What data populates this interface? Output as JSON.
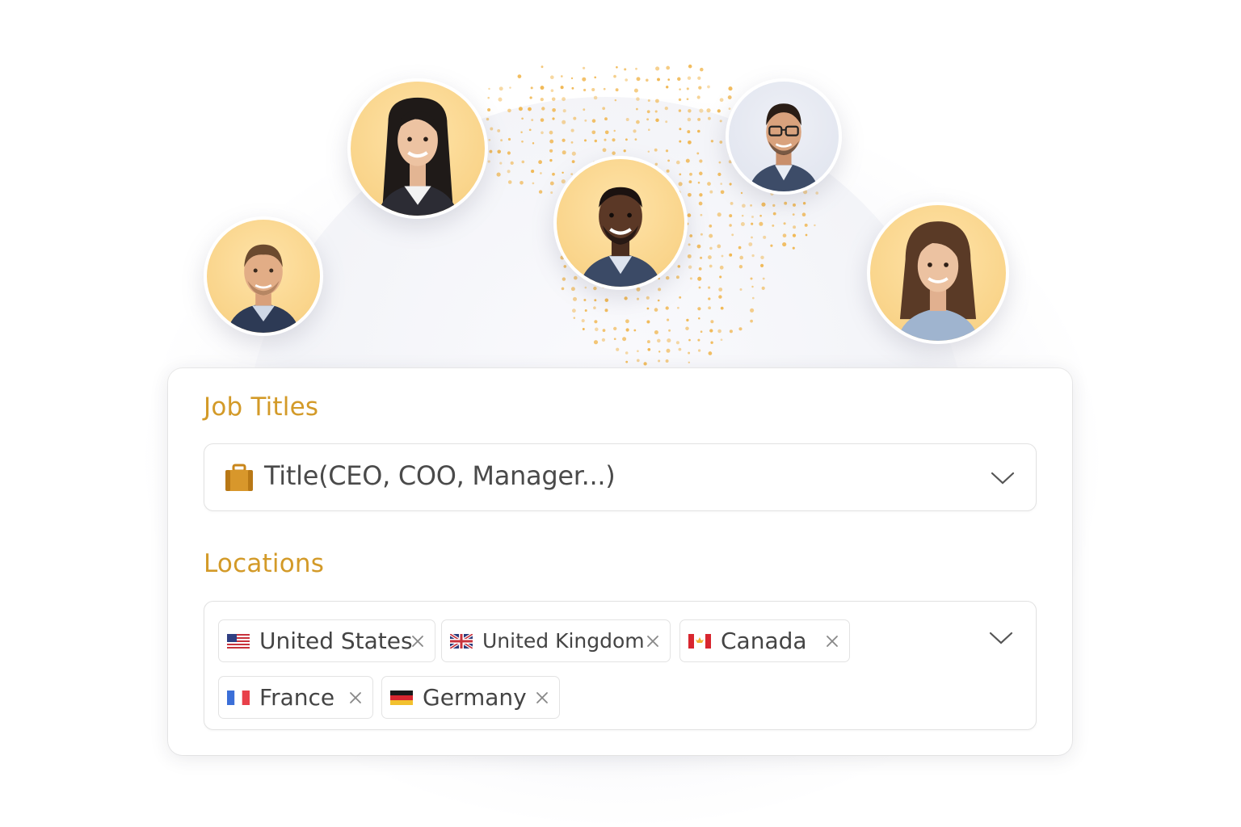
{
  "avatars": [
    {
      "name": "person-avatar-1"
    },
    {
      "name": "person-avatar-2"
    },
    {
      "name": "person-avatar-3"
    },
    {
      "name": "person-avatar-4"
    },
    {
      "name": "person-avatar-5"
    }
  ],
  "filters": {
    "job_titles": {
      "label": "Job Titles",
      "placeholder": "Title(CEO, COO, Manager...)",
      "icon": "briefcase-icon"
    },
    "locations": {
      "label": "Locations",
      "chips": [
        {
          "label": "United States",
          "flag": "us-flag-icon"
        },
        {
          "label": "United Kingdom",
          "flag": "uk-flag-icon"
        },
        {
          "label": "Canada",
          "flag": "canada-flag-icon"
        },
        {
          "label": "France",
          "flag": "france-flag-icon"
        },
        {
          "label": "Germany",
          "flag": "germany-flag-icon"
        }
      ]
    }
  },
  "colors": {
    "accent": "#d39a28",
    "avatar_bg": "#f9d48a",
    "dots": "#f0b44a"
  }
}
